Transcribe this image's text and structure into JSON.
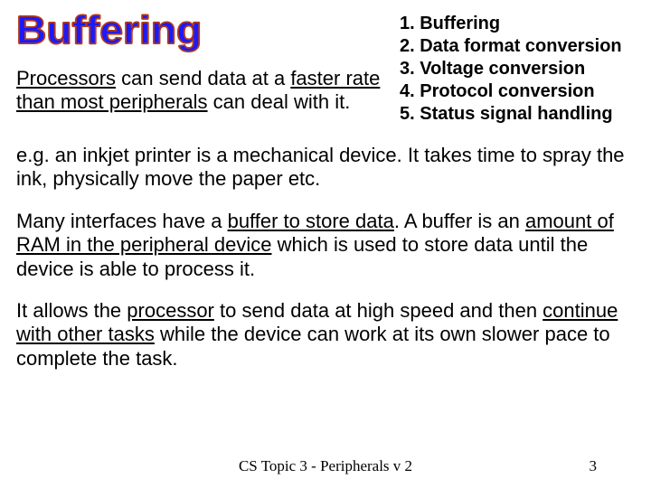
{
  "title": "Buffering",
  "list": {
    "i1": "1. Buffering",
    "i2": "2. Data format conversion",
    "i3": "3. Voltage conversion",
    "i4": "4. Protocol conversion",
    "i5": "5. Status signal handling"
  },
  "intro": {
    "t1": "Processors",
    "t2": " can send data at a ",
    "t3": "faster rate than most peripherals",
    "t4": " can deal with it."
  },
  "p1": "e.g. an inkjet printer is a mechanical device.  It takes time to spray the ink, physically move the paper etc.",
  "p2": {
    "a": "Many interfaces have a ",
    "b": "buffer to store data",
    "c": ".  A buffer is an ",
    "d": "amount of RAM in the peripheral device",
    "e": " which is used to store data until the device is able to process it."
  },
  "p3": {
    "a": "It allows the ",
    "b": "processor",
    "c": " to send data at high speed and then ",
    "d": "continue with other tasks",
    "e": " while the device can work at its own slower pace to complete the task."
  },
  "footer": {
    "center": "CS Topic 3 - Peripherals v 2",
    "page": "3"
  }
}
